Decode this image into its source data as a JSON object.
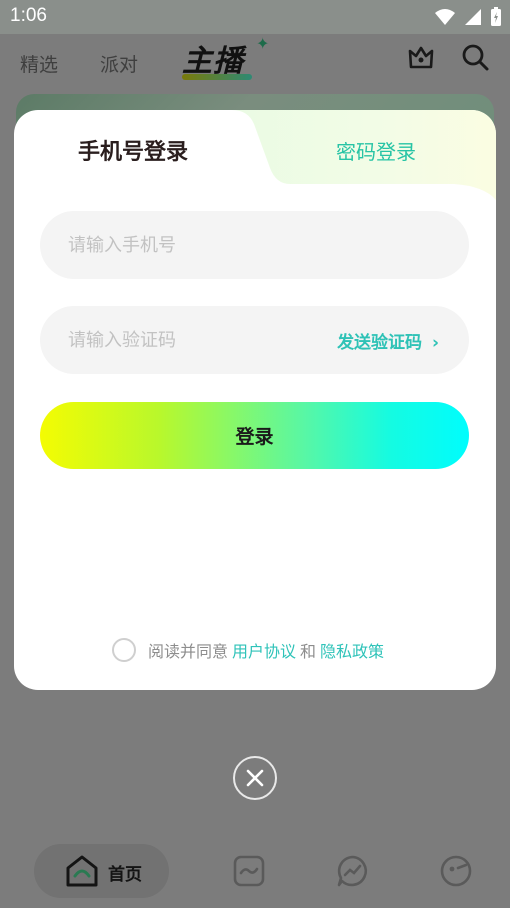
{
  "status_bar": {
    "time": "1:06"
  },
  "top_nav": {
    "tabs": [
      "精选",
      "派对"
    ],
    "brand": "主播"
  },
  "bottom_nav": {
    "home_label": "首页"
  },
  "modal": {
    "tabs": {
      "phone": "手机号登录",
      "password": "密码登录"
    },
    "phone_placeholder": "请输入手机号",
    "code_placeholder": "请输入验证码",
    "send_code": "发送验证码",
    "login_button": "登录",
    "agreement": {
      "prefix": "阅读并同意",
      "user_agreement": "用户协议",
      "and": "和",
      "privacy_policy": "隐私政策"
    }
  },
  "colors": {
    "accent": "#2ec2b6",
    "gradient_start": "#f4fc02",
    "gradient_end": "#00fdfd"
  }
}
